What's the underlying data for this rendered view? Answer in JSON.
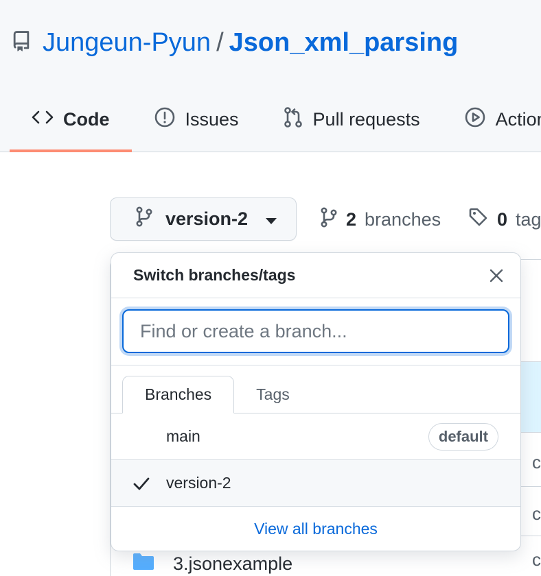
{
  "repo": {
    "owner": "Jungeun-Pyun",
    "separator": "/",
    "name": "Json_xml_parsing"
  },
  "tabs": [
    {
      "label": "Code",
      "icon": "code-icon",
      "active": true
    },
    {
      "label": "Issues",
      "icon": "issue-opened-icon"
    },
    {
      "label": "Pull requests",
      "icon": "git-pull-request-icon"
    },
    {
      "label": "Actions",
      "icon": "play-icon"
    }
  ],
  "branch_button": {
    "label": "version-2"
  },
  "meta": {
    "branches_count": "2",
    "branches_label": "branches",
    "tags_count": "0",
    "tags_label": "tags"
  },
  "dropdown": {
    "title": "Switch branches/tags",
    "filter_placeholder": "Find or create a branch...",
    "tab_branches": "Branches",
    "tab_tags": "Tags",
    "items": [
      {
        "label": "main",
        "badge": "default",
        "selected": false
      },
      {
        "label": "version-2",
        "badge": "",
        "selected": true
      }
    ],
    "footer_link": "View all branches"
  },
  "background": {
    "peek_row_1": "c",
    "peek_row_2": "c",
    "peek_row_3": "c",
    "file_item": "3.jsonexample"
  },
  "colors": {
    "link": "#0969da",
    "active_tab_underline": "#fd8c73",
    "folder": "#54aeff"
  }
}
